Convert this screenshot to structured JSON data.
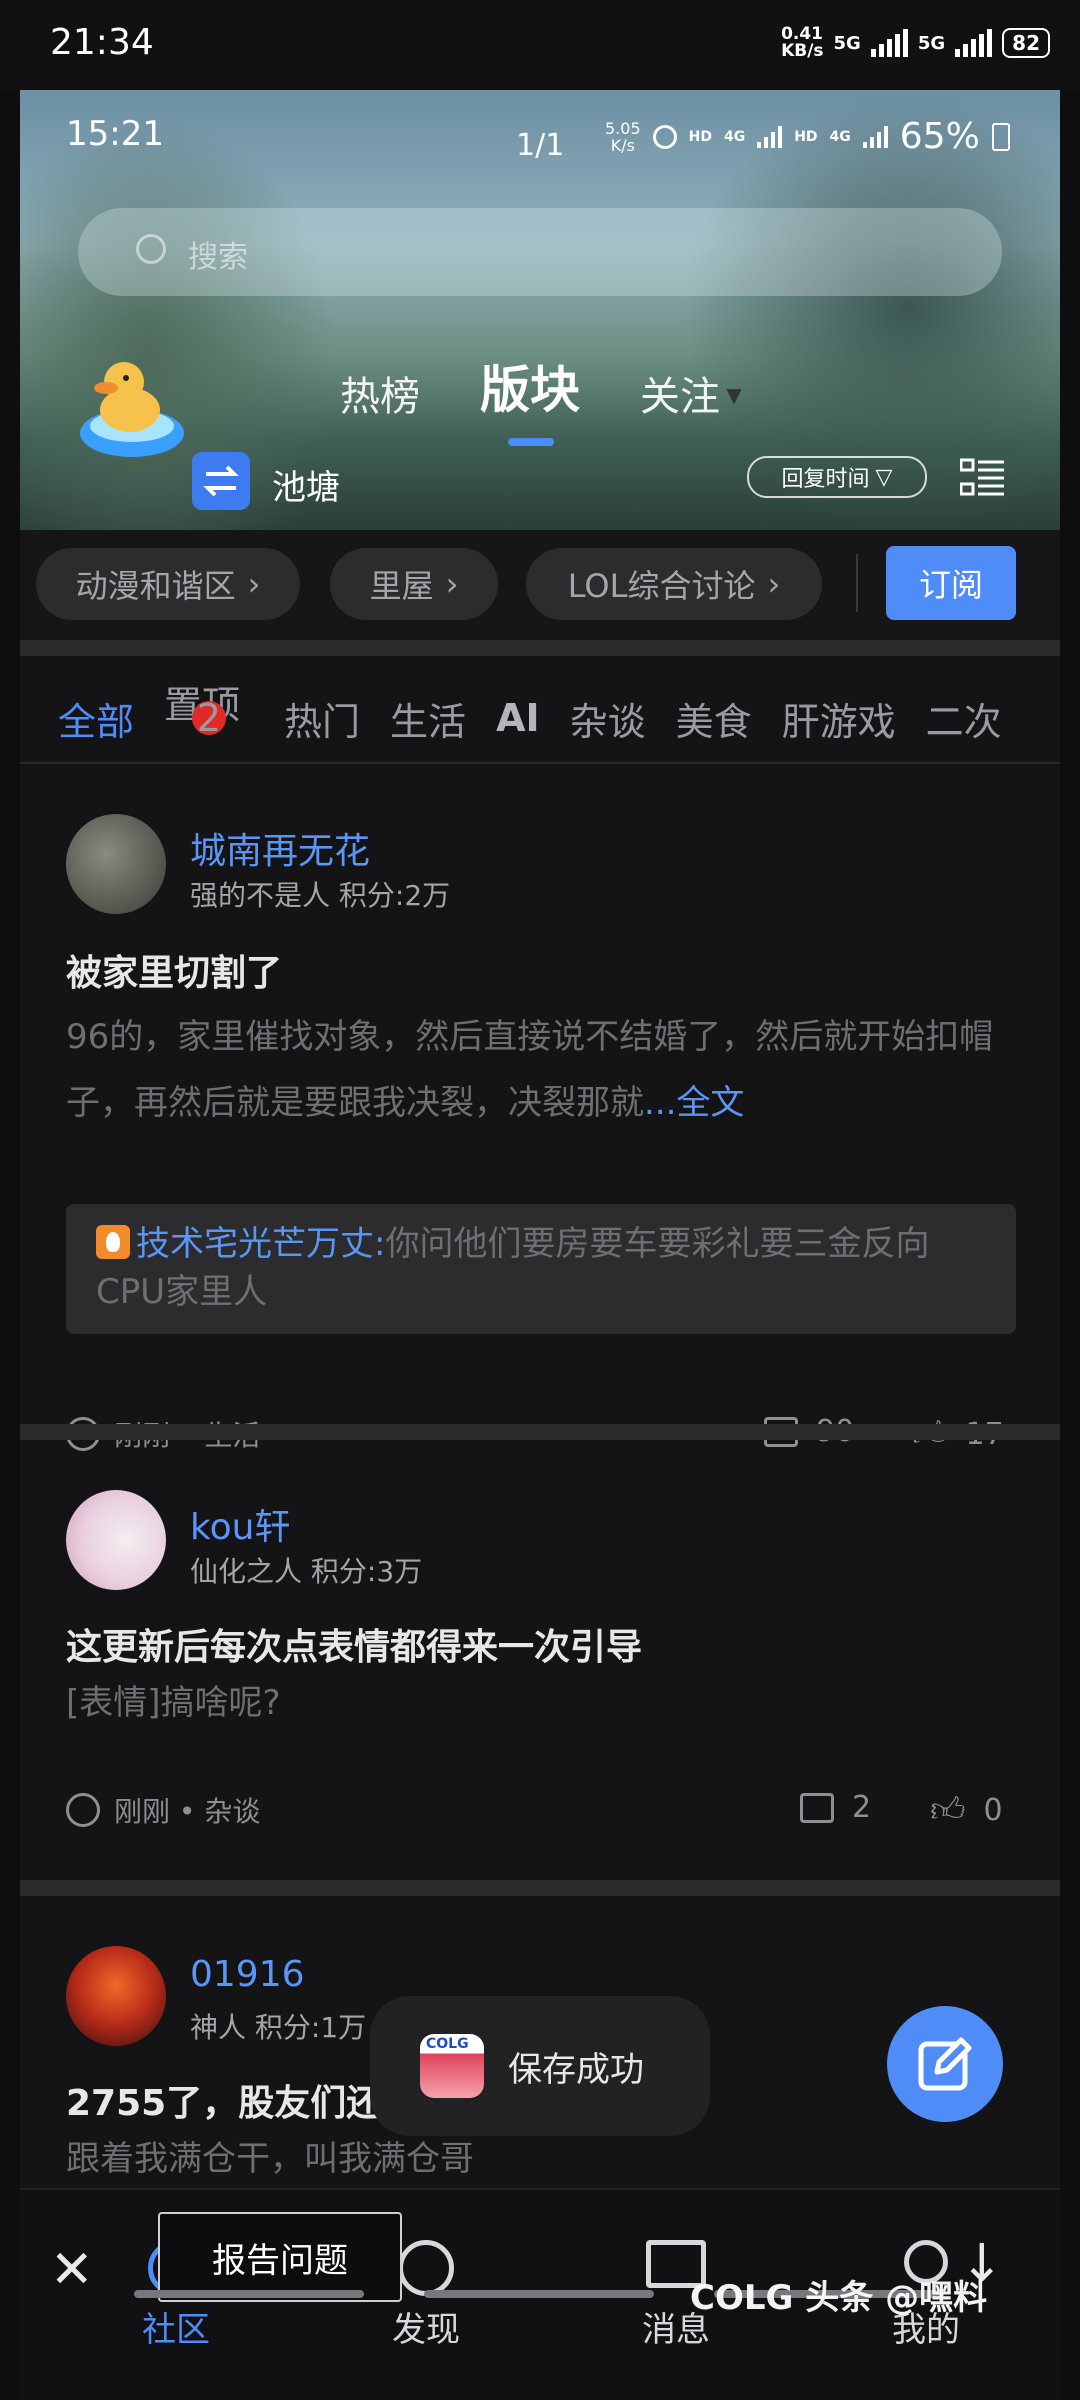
{
  "outer_status": {
    "time": "21:34",
    "speed": "0.41\nKB/s",
    "net1": "5G",
    "net2": "5G",
    "battery": "82"
  },
  "inner_status": {
    "time": "15:21",
    "page": "1/1",
    "speed": "5.05\nK/s",
    "hd1": "HD",
    "net1": "4G",
    "hd2": "HD",
    "net2": "4G",
    "battery": "65%"
  },
  "search": {
    "placeholder": "搜索"
  },
  "top_tabs": [
    {
      "label": "热榜"
    },
    {
      "label": "版块"
    },
    {
      "label": "关注"
    }
  ],
  "pond": {
    "label": "池塘"
  },
  "reply_time": {
    "label": "回复时间"
  },
  "chips": [
    {
      "label": "动漫和谐区"
    },
    {
      "label": "里屋"
    },
    {
      "label": "LOL综合讨论"
    }
  ],
  "subscribe": {
    "label": "订阅"
  },
  "categories": [
    {
      "label": "全部"
    },
    {
      "label": "置顶"
    },
    {
      "label": "热门"
    },
    {
      "label": "生活"
    },
    {
      "label": "AI"
    },
    {
      "label": "杂谈"
    },
    {
      "label": "美食"
    },
    {
      "label": "肝游戏"
    },
    {
      "label": "二次"
    }
  ],
  "pinned_badge": "2",
  "posts": [
    {
      "user": "城南再无花",
      "meta": "强的不是人  积分:2万",
      "title": "被家里切割了",
      "body": "96的，家里催找对象，然后直接说不结婚了，然后就开始扣帽子，再然后就是要跟我决裂，决裂那就",
      "more": "...全文",
      "quote_name": "技术宅光芒万丈:",
      "quote_text": "你问他们要房要车要彩礼要三金反向CPU家里人",
      "time": "刚刚 • 生活",
      "comments": "90",
      "likes": "17"
    },
    {
      "user": "kou轩",
      "meta": "仙化之人  积分:3万",
      "title": "这更新后每次点表情都得来一次引导",
      "body": "[表情]搞啥呢?",
      "time": "刚刚 • 杂谈",
      "comments": "2",
      "likes": "0"
    },
    {
      "user": "01916",
      "meta": "神人  积分:1万",
      "title": "2755了，股友们还",
      "body": "跟着我满仓干，叫我满仓哥"
    }
  ],
  "toast": {
    "text": "保存成功"
  },
  "report": {
    "label": "报告问题"
  },
  "nav": [
    {
      "label": "社区"
    },
    {
      "label": "发现"
    },
    {
      "label": "消息"
    },
    {
      "label": "我的"
    }
  ],
  "watermark": "COLG  头条 @嘿料",
  "colors": {
    "accent": "#4f8cf7",
    "badge": "#e02a2a",
    "bg": "#141416"
  }
}
